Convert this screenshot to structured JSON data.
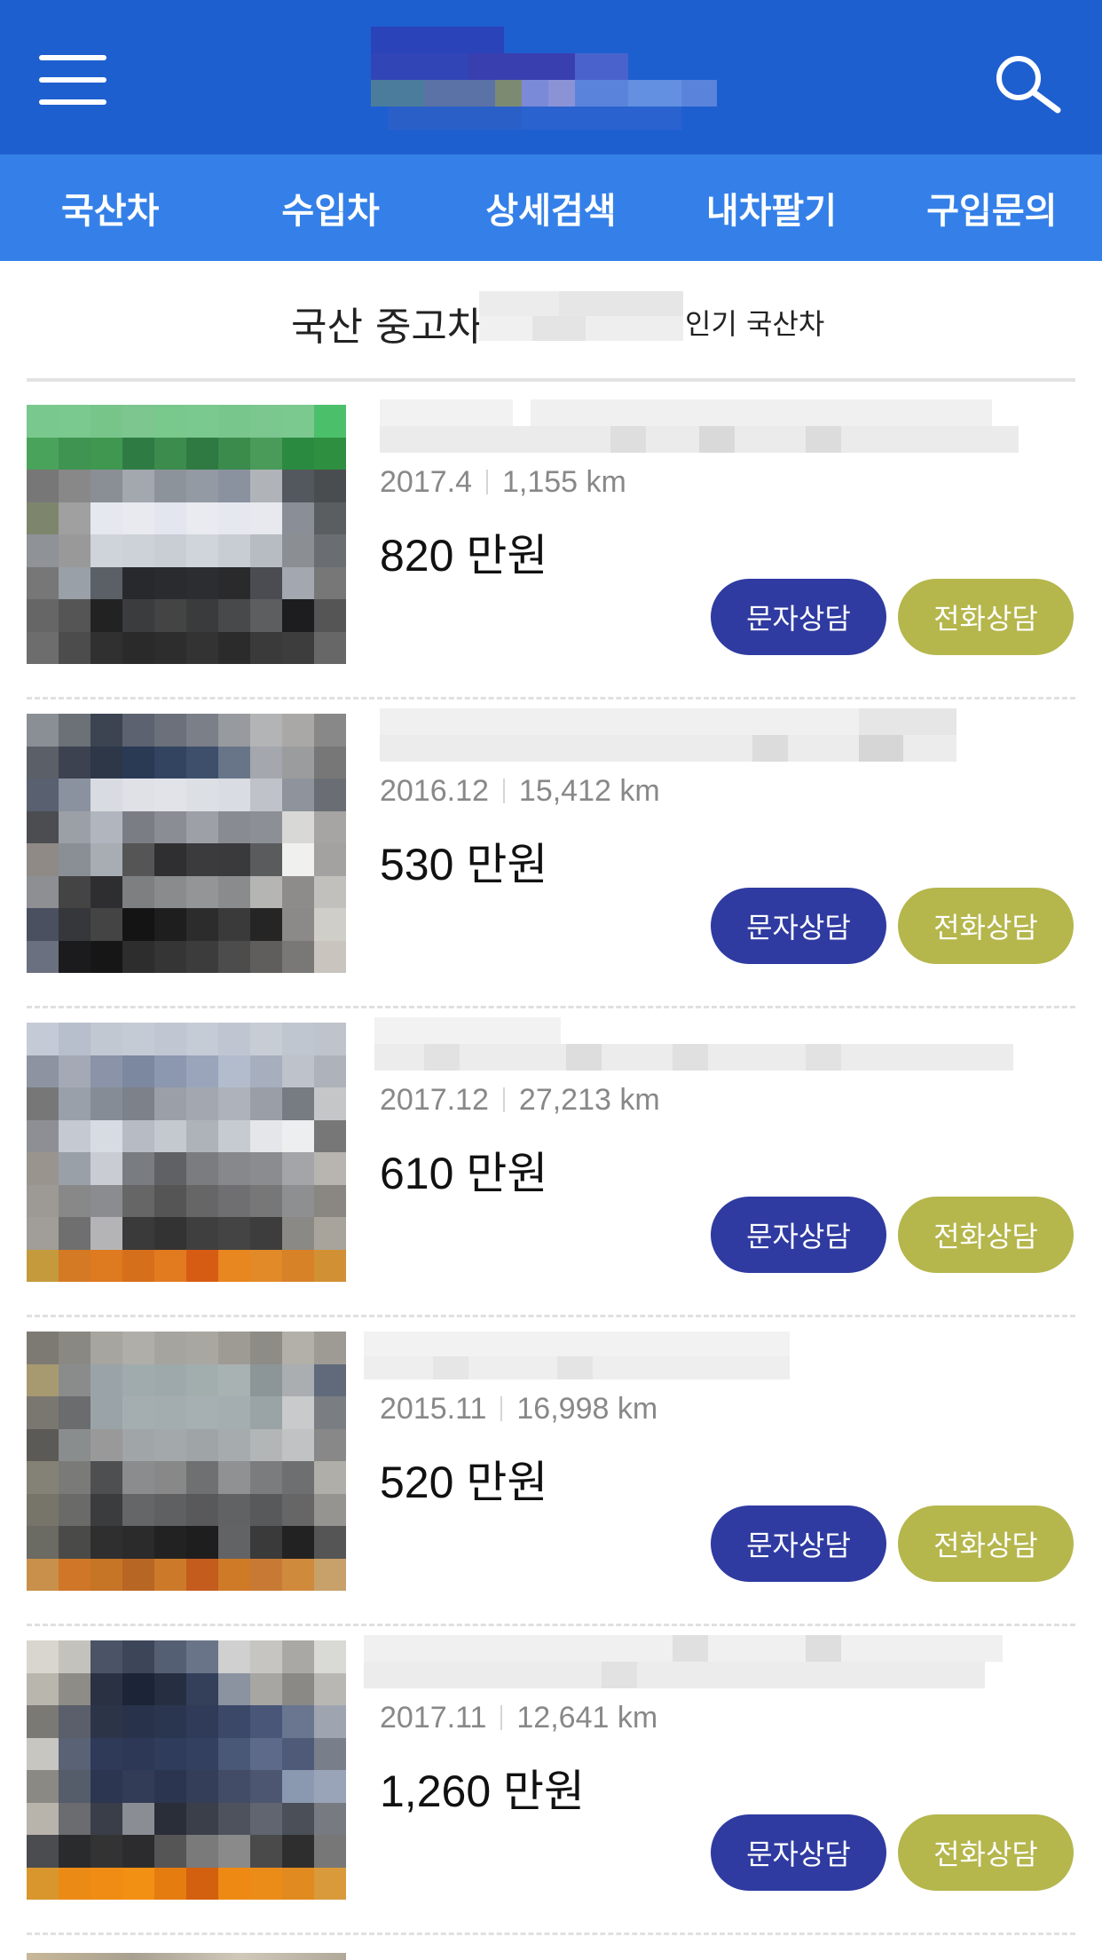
{
  "header": {
    "menu_icon": "hamburger-menu-icon",
    "search_icon": "search-icon",
    "brand_color": "#1e5fd0"
  },
  "nav": {
    "items": [
      {
        "label": "국산차"
      },
      {
        "label": "수입차"
      },
      {
        "label": "상세검색"
      },
      {
        "label": "내차팔기"
      },
      {
        "label": "구입문의"
      }
    ],
    "color": "#3480e8"
  },
  "section": {
    "title": "국산 중고차",
    "subtitle": "인기 국산차"
  },
  "buttons": {
    "sms": "문자상담",
    "call": "전화상담",
    "sms_color": "#2f3ba1",
    "call_color": "#b5b64c"
  },
  "listings": [
    {
      "date": "2017.4",
      "mileage": "1,155 km",
      "price": "820 만원"
    },
    {
      "date": "2016.12",
      "mileage": "15,412 km",
      "price": "530 만원"
    },
    {
      "date": "2017.12",
      "mileage": "27,213 km",
      "price": "610 만원"
    },
    {
      "date": "2015.11",
      "mileage": "16,998 km",
      "price": "520 만원"
    },
    {
      "date": "2017.11",
      "mileage": "12,641 km",
      "price": "1,260 만원"
    }
  ]
}
